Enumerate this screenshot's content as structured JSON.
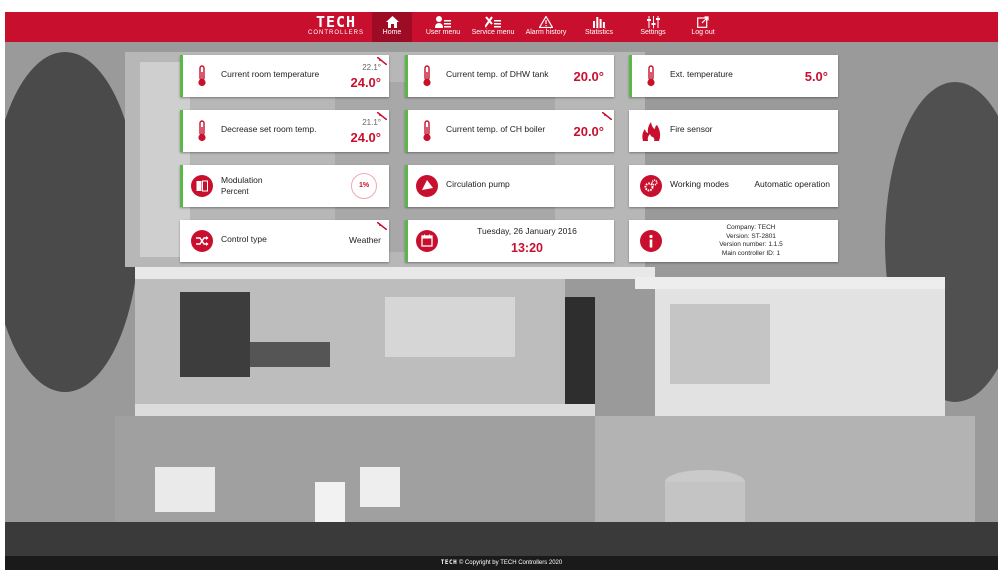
{
  "brand": {
    "name": "TECH",
    "sub": "CONTROLLERS"
  },
  "nav": [
    {
      "label": "Home",
      "icon": "home-icon"
    },
    {
      "label": "User menu",
      "icon": "user-menu-icon"
    },
    {
      "label": "Service menu",
      "icon": "service-menu-icon"
    },
    {
      "label": "Alarm history",
      "icon": "alarm-icon"
    },
    {
      "label": "Statistics",
      "icon": "statistics-icon"
    },
    {
      "label": "Settings",
      "icon": "settings-icon"
    },
    {
      "label": "Log out",
      "icon": "logout-icon"
    }
  ],
  "tiles": {
    "room_temp": {
      "label": "Current room temperature",
      "small": "22.1°",
      "big": "24.0°"
    },
    "dhw": {
      "label": "Current temp. of DHW tank",
      "big": "20.0°"
    },
    "ext": {
      "label": "Ext. temperature",
      "big": "5.0°"
    },
    "decrease": {
      "label": "Decrease set room temp.",
      "small": "21.1°",
      "big": "24.0°"
    },
    "ch_boiler": {
      "label": "Current temp. of CH boiler",
      "big": "20.0°"
    },
    "fire": {
      "label": "Fire sensor"
    },
    "modulation": {
      "label": "Modulation",
      "sub": "Percent",
      "value": "1%"
    },
    "pump": {
      "label": "Circulation pump"
    },
    "modes": {
      "label": "Working modes",
      "value": "Automatic operation"
    },
    "control": {
      "label": "Control type",
      "value": "Weather"
    },
    "datetime": {
      "date": "Tuesday, 26 January 2016",
      "time": "13:20"
    },
    "info": {
      "company": "Company: TECH",
      "version": "Version: ST-2801",
      "version_number": "Version number: 1.1.5",
      "controller_id": "Main controller ID: 1"
    }
  },
  "footer": {
    "brand": "TECH",
    "text": "© Copyright by TECH Controllers 2020"
  },
  "colors": {
    "accent": "#c8102e",
    "green": "#5ab847"
  }
}
